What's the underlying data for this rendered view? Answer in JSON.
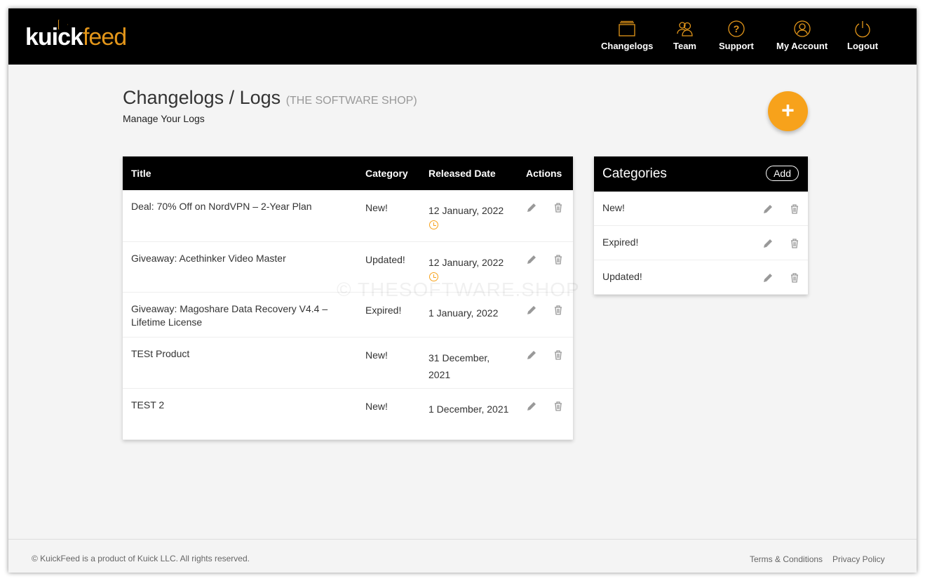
{
  "brand": {
    "logo_text": [
      "kuick",
      "feed"
    ]
  },
  "nav": [
    {
      "label": "Changelogs",
      "icon": "folder-icon"
    },
    {
      "label": "Team",
      "icon": "team-icon"
    },
    {
      "label": "Support",
      "icon": "question-icon"
    },
    {
      "label": "My Account",
      "icon": "user-icon"
    },
    {
      "label": "Logout",
      "icon": "power-icon"
    }
  ],
  "page": {
    "title": "Changelogs / Logs",
    "org": "(THE SOFTWARE SHOP)",
    "subtitle": "Manage Your Logs",
    "add_button": "+"
  },
  "table": {
    "headers": [
      "Title",
      "Category",
      "Released Date",
      "Actions"
    ],
    "rows": [
      {
        "title": "Deal: 70% Off on NordVPN – 2-Year Plan",
        "category": "New!",
        "date": "12 January, 2022",
        "scheduled": true
      },
      {
        "title": "Giveaway: Acethinker Video Master",
        "category": "Updated!",
        "date": "12 January, 2022",
        "scheduled": true
      },
      {
        "title": "Giveaway: Magoshare Data Recovery V4.4 – Lifetime License",
        "category": "Expired!",
        "date": "1 January, 2022",
        "scheduled": false
      },
      {
        "title": "TESt Product",
        "category": "New!",
        "date": "31 December, 2021",
        "scheduled": false
      },
      {
        "title": "TEST 2",
        "category": "New!",
        "date": "1 December, 2021",
        "scheduled": false
      }
    ]
  },
  "categories": {
    "title": "Categories",
    "add_label": "Add",
    "items": [
      "New!",
      "Expired!",
      "Updated!"
    ]
  },
  "watermark": "© THESOFTWARE.SHOP",
  "footer": {
    "copyright": "© KuickFeed is a product of Kuick LLC. All rights reserved.",
    "links": [
      "Terms & Conditions",
      "Privacy Policy"
    ]
  },
  "colors": {
    "accent": "#f7a21b",
    "header": "#000000",
    "background": "#f4f4f4"
  }
}
